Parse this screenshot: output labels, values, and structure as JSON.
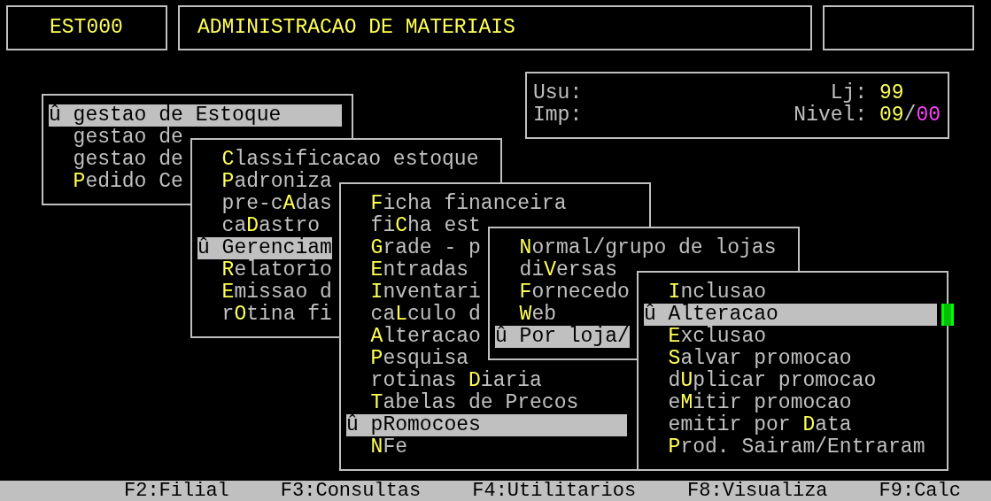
{
  "header": {
    "program_code": "EST000",
    "title": "ADMINISTRACAO DE MATERIAIS"
  },
  "info": {
    "user_label": "Usu:",
    "store_label": "Lj:",
    "store": "99",
    "printer_label": "Imp:",
    "level_label": "Nivel:",
    "level_major": "09",
    "level_separator": "/",
    "level_minor": "00"
  },
  "menus": [
    {
      "items": [
        {
          "marker": "û",
          "pre": "gestao de ",
          "key": "E",
          "post": "stoque",
          "selected": true
        },
        {
          "pre": "gestao de",
          "selected": false
        },
        {
          "pre": "gestao de",
          "selected": false
        },
        {
          "key": "P",
          "post": "edido Ce",
          "selected": false
        }
      ]
    },
    {
      "items": [
        {
          "key": "C",
          "post": "lassificacao estoque",
          "selected": false
        },
        {
          "key": "P",
          "post": "adroniza",
          "selected": false
        },
        {
          "pre": "pre-c",
          "key": "A",
          "post": "das",
          "selected": false
        },
        {
          "pre": "ca",
          "key": "D",
          "post": "astro",
          "selected": false
        },
        {
          "marker": "û",
          "key": "G",
          "post": "erenciam",
          "selected": true
        },
        {
          "key": "R",
          "post": "elatorio",
          "selected": false
        },
        {
          "key": "E",
          "post": "missao d",
          "selected": false
        },
        {
          "pre": "r",
          "key": "O",
          "post": "tina fi",
          "selected": false
        }
      ]
    },
    {
      "items": [
        {
          "key": "F",
          "post": "icha financeira",
          "selected": false
        },
        {
          "pre": "fi",
          "key": "C",
          "post": "ha est",
          "selected": false
        },
        {
          "key": "G",
          "post": "rade - p",
          "selected": false
        },
        {
          "key": "E",
          "post": "ntradas",
          "selected": false
        },
        {
          "key": "I",
          "post": "nventari",
          "selected": false
        },
        {
          "pre": "ca",
          "key": "L",
          "post": "culo d",
          "selected": false
        },
        {
          "key": "A",
          "post": "lteracao",
          "selected": false
        },
        {
          "key": "P",
          "post": "esquisa",
          "selected": false
        },
        {
          "pre": "rotinas ",
          "key": "D",
          "post": "iaria",
          "selected": false
        },
        {
          "key": "T",
          "post": "abelas de Precos",
          "selected": false
        },
        {
          "marker": "û",
          "pre": "p",
          "key": "R",
          "post": "omocoes",
          "selected": true
        },
        {
          "key": "N",
          "post": "Fe",
          "selected": false
        }
      ]
    },
    {
      "items": [
        {
          "key": "N",
          "post": "ormal/grupo de lojas",
          "selected": false
        },
        {
          "pre": "di",
          "key": "V",
          "post": "ersas",
          "selected": false
        },
        {
          "key": "F",
          "post": "ornecedo",
          "selected": false
        },
        {
          "key": "W",
          "post": "eb",
          "selected": false
        },
        {
          "marker": "û",
          "key": "P",
          "post": "or loja/",
          "selected": true
        }
      ]
    },
    {
      "items": [
        {
          "key": "I",
          "post": "nclusao",
          "selected": false
        },
        {
          "marker": "û",
          "key": "A",
          "post": "lteracao",
          "selected": true
        },
        {
          "key": "E",
          "post": "xclusao",
          "selected": false
        },
        {
          "key": "S",
          "post": "alvar promocao",
          "selected": false
        },
        {
          "pre": "d",
          "key": "U",
          "post": "plicar promocao",
          "selected": false
        },
        {
          "pre": "e",
          "key": "M",
          "post": "itir promocao",
          "selected": false
        },
        {
          "pre": "emitir por ",
          "key": "D",
          "post": "ata",
          "selected": false
        },
        {
          "key": "P",
          "post": "rod. Sairam/Entraram",
          "selected": false
        }
      ]
    }
  ],
  "function_keys": [
    "F2:Filial",
    "F3:Consultas",
    "F4:Utilitarios",
    "F8:Visualiza",
    "F9:Calc"
  ]
}
